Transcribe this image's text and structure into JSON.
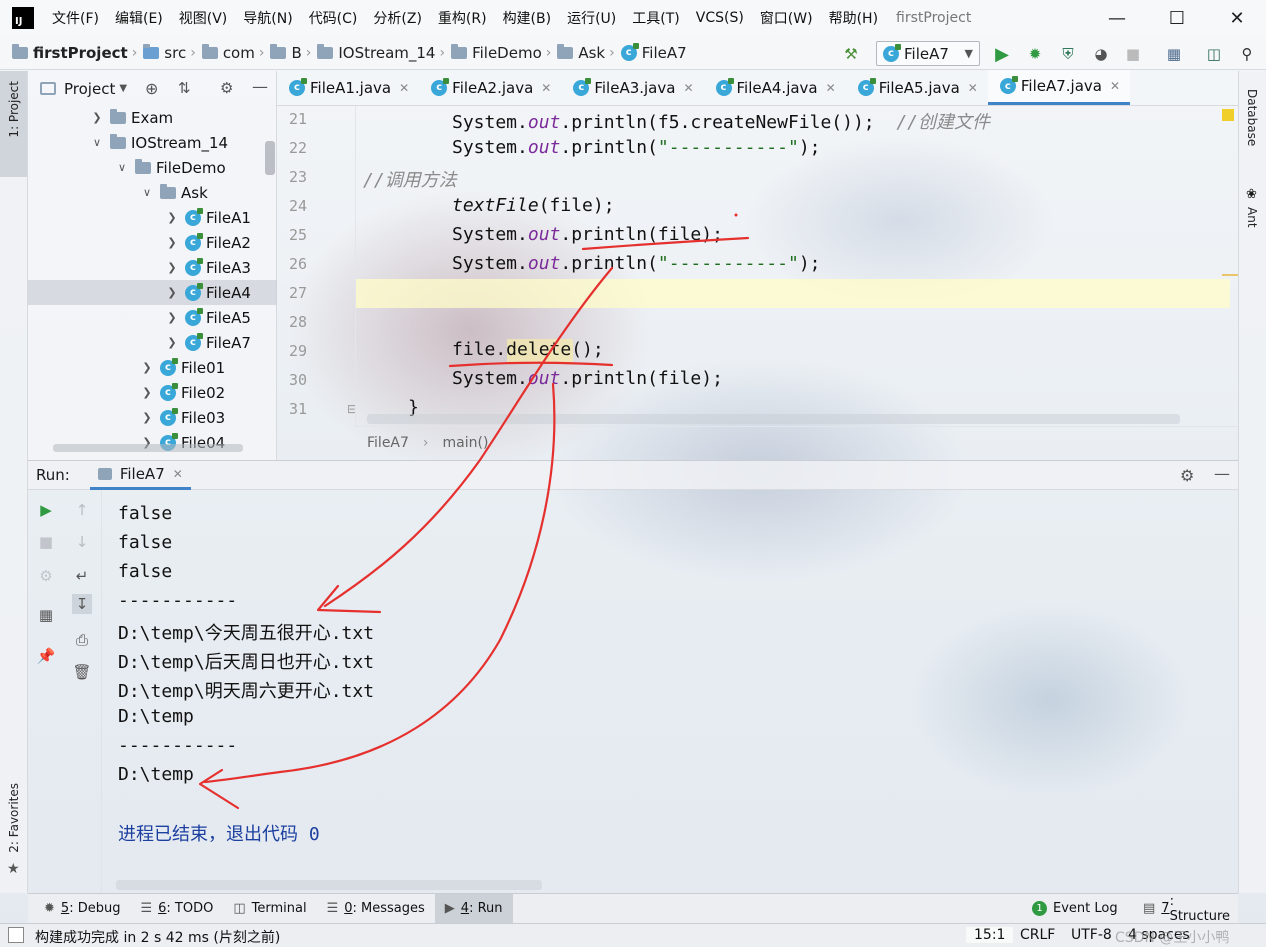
{
  "menubar": {
    "logo_text": "IJ",
    "items": [
      "文件(F)",
      "编辑(E)",
      "视图(V)",
      "导航(N)",
      "代码(C)",
      "分析(Z)",
      "重构(R)",
      "构建(B)",
      "运行(U)",
      "工具(T)",
      "VCS(S)",
      "窗口(W)",
      "帮助(H)"
    ],
    "window_title": "firstProject"
  },
  "navbar": {
    "crumbs": [
      "firstProject",
      "src",
      "com",
      "B",
      "IOStream_14",
      "FileDemo",
      "Ask",
      "FileA7"
    ],
    "run_config": "FileA7"
  },
  "left_strip": {
    "project_tab": "1: Project",
    "favorites_tab": "2: Favorites"
  },
  "right_strip": {
    "database_tab": "Database",
    "ant_tab": "Ant"
  },
  "project_panel": {
    "title": "Project",
    "tree": [
      {
        "label": "Exam",
        "kind": "folder"
      },
      {
        "label": "IOStream_14",
        "kind": "folder"
      },
      {
        "label": "FileDemo",
        "kind": "folder"
      },
      {
        "label": "Ask",
        "kind": "folder"
      },
      {
        "label": "FileA1",
        "kind": "class"
      },
      {
        "label": "FileA2",
        "kind": "class"
      },
      {
        "label": "FileA3",
        "kind": "class"
      },
      {
        "label": "FileA4",
        "kind": "class"
      },
      {
        "label": "FileA5",
        "kind": "class"
      },
      {
        "label": "FileA7",
        "kind": "class"
      },
      {
        "label": "File01",
        "kind": "class"
      },
      {
        "label": "File02",
        "kind": "class"
      },
      {
        "label": "File03",
        "kind": "class"
      },
      {
        "label": "File04",
        "kind": "class"
      }
    ]
  },
  "editor": {
    "tabs": [
      "FileA1.java",
      "FileA2.java",
      "FileA3.java",
      "FileA4.java",
      "FileA5.java",
      "FileA7.java"
    ],
    "active_tab": "FileA7.java",
    "line_numbers": [
      "21",
      "22",
      "23",
      "24",
      "25",
      "26",
      "27",
      "28",
      "29",
      "30",
      "31"
    ],
    "code": {
      "l21_a": "System.",
      "l21_out": "out",
      "l21_b": ".println(f5.createNewFile());  ",
      "l21_cmt": "//创建文件",
      "l22_a": "System.",
      "l22_out": "out",
      "l22_b": ".println(",
      "l22_str": "\"-----------\"",
      "l22_c": ");",
      "l23_cmt": "//调用方法",
      "l24_it": "textFile",
      "l24_b": "(file);",
      "l25_a": "System.",
      "l25_out": "out",
      "l25_b": ".println(file);",
      "l26_a": "System.",
      "l26_out": "out",
      "l26_b": ".println(",
      "l26_str": "\"-----------\"",
      "l26_c": ");",
      "l29": "file.delete();",
      "l30_a": "System.",
      "l30_out": "out",
      "l30_b": ".println(file);",
      "l31": "}"
    },
    "breadcrumb": [
      "FileA7",
      "main()"
    ]
  },
  "run_panel": {
    "label": "Run:",
    "tab": "FileA7",
    "console_lines": [
      "false",
      "false",
      "false",
      "-----------",
      "D:\\temp\\今天周五很开心.txt",
      "D:\\temp\\后天周日也开心.txt",
      "D:\\temp\\明天周六更开心.txt",
      "D:\\temp",
      "-----------",
      "D:\\temp"
    ],
    "exit_message": "进程已结束，退出代码 0"
  },
  "bottom_tabs": [
    {
      "num": "5",
      "label": ": Debug"
    },
    {
      "num": "6",
      "label": ": TODO"
    },
    {
      "num": "",
      "label": "Terminal"
    },
    {
      "num": "0",
      "label": ": Messages"
    },
    {
      "num": "4",
      "label": ": Run"
    }
  ],
  "right_tabs": {
    "event_log": "Event Log",
    "structure_num": "7",
    "structure": ": Structure"
  },
  "status": {
    "message": "构建成功完成 in 2 s 42 ms (片刻之前)",
    "position": "15:1",
    "line_sep": "CRLF",
    "encoding": "UTF-8",
    "indent": "4 spaces",
    "watermark": "CSDN @王小小鸭"
  },
  "colors": {
    "accent": "#4083c9",
    "run_green": "#2f9a41",
    "annotation_red": "#e5302e"
  }
}
